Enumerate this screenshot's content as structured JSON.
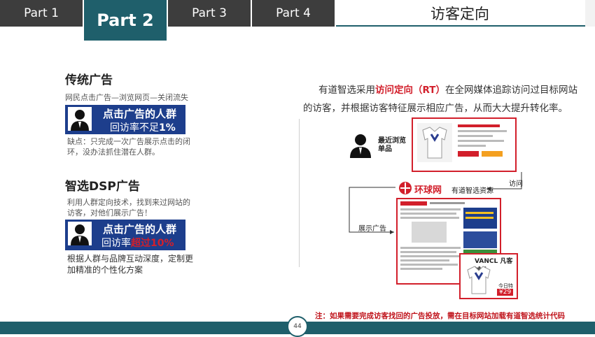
{
  "tabs": [
    "Part 1",
    "Part 2",
    "Part 3",
    "Part 4"
  ],
  "header_title": "访客定向",
  "traditional": {
    "title": "传统广告",
    "flow": "网民点击广告—浏览网页—关闭流失",
    "box_line1": "点击广告的人群",
    "box_line2_prefix": "回访率不足",
    "box_line2_value": "1%",
    "drawback": "缺点：只完成一次广告展示点击的闭环，没办法抓住潜在人群。"
  },
  "dsp": {
    "title": "智选DSP广告",
    "intro": "利用人群定向技术，找到来过网站的访客，对他们展示广告！",
    "box_line1": "点击广告的人群",
    "box_line2_prefix": "回访率",
    "box_line2_value": "超过10%",
    "benefit": "根据人群与品牌互动深度，定制更加精准的个性化方案"
  },
  "description": {
    "pre": "有道智选采用",
    "highlight": "访问定向（RT）",
    "post": "在全网媒体追踪访问过目标网站的访客，并根据访客特征展示相应广告，从而大大提升转化率。"
  },
  "diagram": {
    "recent_browse": "最近浏览单品",
    "site_logo": "环球网",
    "youdao_resource": "有道智选资源",
    "visit": "访问",
    "show_ad": "展示广告",
    "brand": "VANCL 凡客诚品",
    "today_price_label": "今日特价",
    "today_price": "¥29"
  },
  "note": "注：如果需要完成访客找回的广告投放，需在目标网站加载有道智选统计代码",
  "page_number": "44",
  "colors": {
    "teal": "#1f5f6b",
    "dark_tab": "#3d3d3d",
    "blue_box": "#1d3e8c",
    "red": "#d21f2b"
  }
}
